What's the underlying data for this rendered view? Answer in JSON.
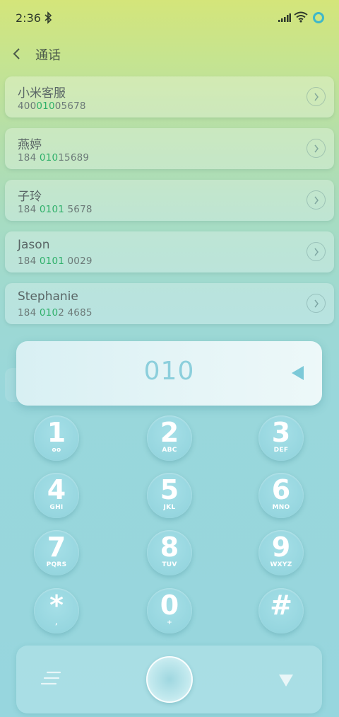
{
  "status_bar": {
    "time": "2:36"
  },
  "header": {
    "title": "通话"
  },
  "contacts": [
    {
      "name": "小米客服",
      "number_pre": "400",
      "number_hl": "010",
      "number_post": "05678"
    },
    {
      "name": "燕婷",
      "number_pre": "184 ",
      "number_hl": "010",
      "number_post": "15689"
    },
    {
      "name": "子玲",
      "number_pre": "184 ",
      "number_hl": "0101",
      "number_post": " 5678"
    },
    {
      "name": "Jason",
      "number_pre": "184 ",
      "number_hl": "0101",
      "number_post": " 0029"
    },
    {
      "name": "Stephanie",
      "number_pre": "184 ",
      "number_hl": "010",
      "number_post": "2 4685"
    }
  ],
  "dialer": {
    "value": "010"
  },
  "keypad": [
    {
      "digit": "1",
      "letters": "oo"
    },
    {
      "digit": "2",
      "letters": "ABC"
    },
    {
      "digit": "3",
      "letters": "DEF"
    },
    {
      "digit": "4",
      "letters": "GHI"
    },
    {
      "digit": "5",
      "letters": "JKL"
    },
    {
      "digit": "6",
      "letters": "MNO"
    },
    {
      "digit": "7",
      "letters": "PQRS"
    },
    {
      "digit": "8",
      "letters": "TUV"
    },
    {
      "digit": "9",
      "letters": "WXYZ"
    },
    {
      "digit": "*",
      "letters": ","
    },
    {
      "digit": "0",
      "letters": "+"
    },
    {
      "digit": "#",
      "letters": ""
    }
  ],
  "colors": {
    "accent": "#3fb7c9",
    "match_highlight": "#2fb06a",
    "key_text": "#ffffff"
  },
  "icons": {
    "status": [
      "bluetooth-icon",
      "signal-icon",
      "wifi-icon",
      "ring-icon"
    ],
    "header": "back-icon",
    "contact_action": "chevron-right-icon",
    "dialer": "backspace-icon",
    "bottom": [
      "menu-icon",
      "call-icon",
      "collapse-icon"
    ]
  }
}
